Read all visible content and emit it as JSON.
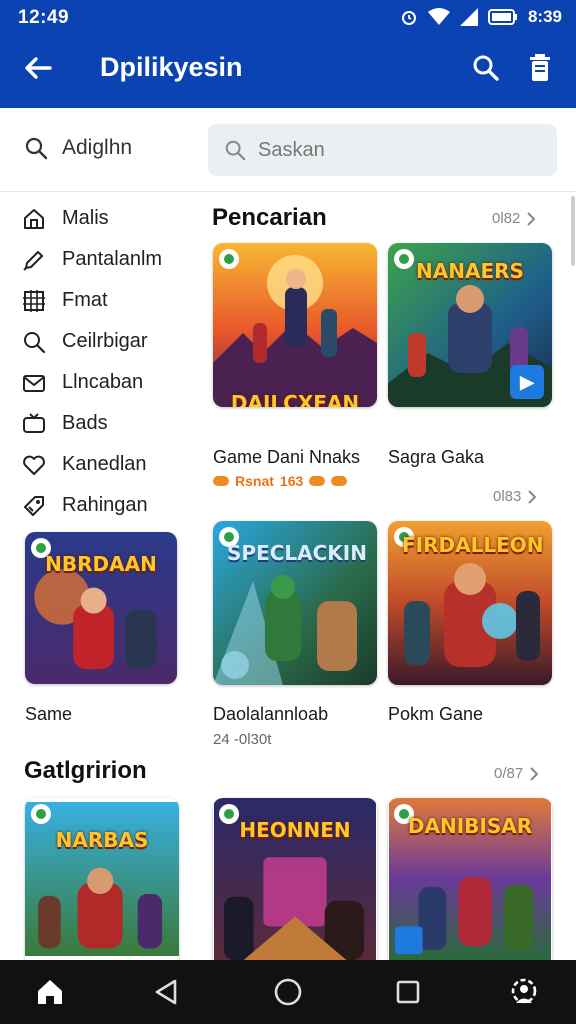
{
  "status": {
    "time": "12:49",
    "battery": "8:39"
  },
  "appbar": {
    "title": "Dpilikyesin"
  },
  "side_search": {
    "label": "Adiglhn"
  },
  "search": {
    "placeholder": "Saskan"
  },
  "sidebar": {
    "items": [
      {
        "label": "Malis",
        "icon": "home-icon"
      },
      {
        "label": "Pantalanlm",
        "icon": "pencil-icon"
      },
      {
        "label": "Fmat",
        "icon": "grid-icon"
      },
      {
        "label": "Ceilrbigar",
        "icon": "search-icon"
      },
      {
        "label": "Llncaban",
        "icon": "mail-icon"
      },
      {
        "label": "Bads",
        "icon": "tv-icon"
      },
      {
        "label": "Kanedlan",
        "icon": "heart-icon"
      },
      {
        "label": "Rahingan",
        "icon": "tag-icon"
      }
    ]
  },
  "section1": {
    "title": "Pencarian",
    "more": "0l82",
    "more2": "0l83",
    "games": [
      {
        "logo": "DAILCXEAN",
        "caption": "Game Dani Nnaks",
        "meta": "Rsnat",
        "meta_value": "163"
      },
      {
        "logo": "NANAERS",
        "caption": "Sagra Gaka"
      },
      {
        "logo": "NBRDAAN",
        "caption": "Same"
      },
      {
        "logo": "SPECLACKIN",
        "caption": "Daolalannloab",
        "sub": "24 -0l30t"
      },
      {
        "logo": "FIRDALLEON",
        "caption": "Pokm Gane"
      }
    ]
  },
  "section2": {
    "title": "Gatlgririon",
    "more": "0/87",
    "games": [
      {
        "logo": "NARBAS"
      },
      {
        "logo": "HEONNEN"
      },
      {
        "logo": "DANIBISAR"
      }
    ]
  },
  "colors": {
    "appbar": "#0b43b3",
    "navbar": "#111111",
    "accent": "#1f7ae0"
  }
}
